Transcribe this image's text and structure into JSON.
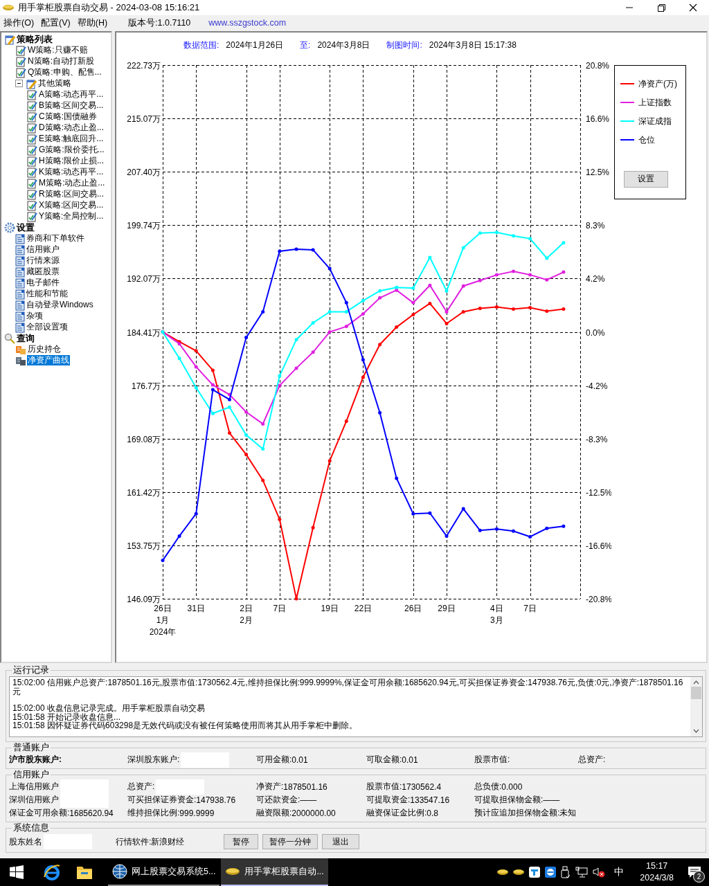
{
  "window": {
    "title": "用手掌柜股票自动交易 - 2024-03-08 15:16:21"
  },
  "menu": [
    "操作(O)",
    "配置(V)",
    "帮助(H)"
  ],
  "version": "版本号:1.0.7110",
  "website": "www.sszgstock.com",
  "sidebar": {
    "tree": [
      {
        "label": "策略列表",
        "kind": "group",
        "selected": false,
        "children": [
          {
            "label": "W策略:只赚不赔",
            "kind": "strategy",
            "selected": false
          },
          {
            "label": "N策略:自动打新股",
            "kind": "strategy",
            "selected": false
          },
          {
            "label": "Q策略:申购、配售...",
            "kind": "strategy",
            "selected": false
          },
          {
            "label": "其他策略",
            "kind": "group",
            "selected": false,
            "expanded": true,
            "children": [
              {
                "label": "A策略:动态再平...",
                "kind": "strategy",
                "selected": false
              },
              {
                "label": "B策略:区间交易...",
                "kind": "strategy",
                "selected": false
              },
              {
                "label": "C策略:国债融券",
                "kind": "strategy",
                "selected": false
              },
              {
                "label": "D策略:动态止盈...",
                "kind": "strategy",
                "selected": false
              },
              {
                "label": "E策略:触底回升...",
                "kind": "strategy",
                "selected": false
              },
              {
                "label": "G策略:限价委托...",
                "kind": "strategy",
                "selected": false
              },
              {
                "label": "H策略:限价止损...",
                "kind": "strategy",
                "selected": false
              },
              {
                "label": "K策略:动态再平...",
                "kind": "strategy",
                "selected": false
              },
              {
                "label": "M策略:动态止盈...",
                "kind": "strategy",
                "selected": false
              },
              {
                "label": "R策略:区间交易...",
                "kind": "strategy",
                "selected": false
              },
              {
                "label": "X策略:区间交易...",
                "kind": "strategy",
                "selected": false
              },
              {
                "label": "Y策略:全局控制...",
                "kind": "strategy",
                "selected": false
              }
            ]
          }
        ]
      },
      {
        "label": "设置",
        "kind": "settings",
        "selected": false,
        "children": [
          {
            "label": "券商和下单软件",
            "kind": "page",
            "selected": false
          },
          {
            "label": "信用账户",
            "kind": "page",
            "selected": false
          },
          {
            "label": "行情来源",
            "kind": "page",
            "selected": false
          },
          {
            "label": "藏匿股票",
            "kind": "page",
            "selected": false
          },
          {
            "label": "电子邮件",
            "kind": "page",
            "selected": false
          },
          {
            "label": "性能和节能",
            "kind": "page",
            "selected": false
          },
          {
            "label": "自动登录Windows",
            "kind": "page",
            "selected": false
          },
          {
            "label": "杂项",
            "kind": "page",
            "selected": false
          },
          {
            "label": "全部设置项",
            "kind": "page",
            "selected": false
          }
        ]
      },
      {
        "label": "查询",
        "kind": "query",
        "selected": false,
        "children": [
          {
            "label": "历史持仓",
            "kind": "history",
            "selected": false
          },
          {
            "label": "净资产曲线",
            "kind": "curve",
            "selected": true
          }
        ]
      }
    ]
  },
  "chart": {
    "header": [
      {
        "label": "数据范围:",
        "value": "2024年1月26日"
      },
      {
        "label": "至:",
        "value": "2024年3月8日"
      },
      {
        "label": "制图时间:",
        "value": "2024年3月8日 15:17:38"
      }
    ],
    "right_axis_labels": [
      "20.8%",
      "16.6%",
      "12.5%",
      "8.3%",
      "4.2%",
      "0.0%",
      "-4.2%",
      "-8.3%",
      "-12.5%",
      "-16.6%",
      "-20.8%"
    ],
    "legend_button": "设置",
    "chart_data": {
      "type": "line",
      "grid": true,
      "categories": [
        "26日\n1月\n2024年",
        null,
        "31日",
        null,
        null,
        "2日\n2月",
        null,
        "7日",
        null,
        null,
        "19日",
        null,
        "22日",
        null,
        null,
        "26日",
        null,
        "29日",
        null,
        null,
        "4日\n3月",
        null,
        "7日",
        null,
        null
      ],
      "ylim": [
        146.09,
        222.73
      ],
      "yticks": [
        {
          "value": 222.73,
          "label": "222.73万"
        },
        {
          "value": 215.07,
          "label": "215.07万"
        },
        {
          "value": 207.4,
          "label": "207.40万"
        },
        {
          "value": 199.74,
          "label": "199.74万"
        },
        {
          "value": 192.07,
          "label": "192.07万"
        },
        {
          "value": 184.41,
          "label": "184.41万"
        },
        {
          "value": 176.75,
          "label": "176.7万"
        },
        {
          "value": 169.08,
          "label": "169.08万"
        },
        {
          "value": 161.42,
          "label": "161.42万"
        },
        {
          "value": 153.75,
          "label": "153.75万"
        },
        {
          "value": 146.09,
          "label": "146.09万"
        }
      ],
      "series": [
        {
          "name": "净资产(万)",
          "color": "#ff0000",
          "values": [
            184.4,
            183.0,
            181.7,
            178.9,
            169.9,
            166.8,
            163.1,
            157.5,
            146.1,
            156.3,
            165.9,
            171.6,
            177.9,
            182.6,
            185.1,
            186.9,
            188.5,
            185.6,
            187.3,
            187.8,
            188.0,
            187.7,
            187.9,
            187.4,
            187.7
          ]
        },
        {
          "name": "上证指数",
          "color": "#e020e0",
          "values": [
            184.4,
            182.7,
            179.4,
            176.8,
            175.4,
            172.9,
            171.2,
            176.7,
            179.2,
            181.5,
            184.4,
            185.2,
            187.0,
            189.3,
            190.4,
            188.6,
            191.1,
            187.3,
            191.0,
            191.8,
            192.6,
            193.1,
            192.6,
            191.9,
            193.0
          ]
        },
        {
          "name": "深证成指",
          "color": "#00ffff",
          "values": [
            184.4,
            180.6,
            176.4,
            172.7,
            173.6,
            169.6,
            167.6,
            178.1,
            183.3,
            185.7,
            187.3,
            187.3,
            188.9,
            190.3,
            190.8,
            190.7,
            195.1,
            190.3,
            196.5,
            198.6,
            198.7,
            198.2,
            197.8,
            195.0,
            197.2
          ]
        },
        {
          "name": "仓位",
          "color": "#0000ff",
          "values": [
            151.6,
            155.1,
            158.3,
            176.1,
            174.7,
            183.6,
            187.3,
            196.0,
            196.3,
            196.2,
            193.5,
            188.6,
            180.4,
            172.8,
            163.4,
            158.3,
            158.4,
            155.1,
            159.0,
            155.9,
            156.1,
            155.8,
            155.0,
            156.2,
            156.5
          ]
        }
      ]
    }
  },
  "log": {
    "title": "运行记录",
    "lines": [
      "15:02:00 信用账户总资产:1878501.16元,股票市值:1730562.4元,维持担保比例:999.9999%,保证金可用余额:1685620.94元,可买担保证券资金:147938.76元,负债:0元,净资产:1878501.16元",
      "15:02:00 收盘信息记录完成。用手掌柜股票自动交易",
      "15:01:58 开始记录收盘信息...",
      "15:01:58 因怀疑证券代码603298是无效代码或没有被任何策略使用而将其从用手掌柜中删除。"
    ]
  },
  "normal_account": {
    "title": "普通账户",
    "fields": [
      {
        "label": "沪市股东账户:",
        "kind": "text"
      },
      {
        "label": "深圳股东账户:",
        "kind": "masked"
      },
      {
        "label": "可用金额:",
        "value": "0.01",
        "kind": "text"
      },
      {
        "label": "可取金额:",
        "value": "0.01",
        "kind": "text"
      },
      {
        "label": "股票市值:",
        "kind": "text"
      },
      {
        "label": "总资产:",
        "kind": "text"
      }
    ]
  },
  "credit_account": {
    "title": "信用账户",
    "fields": [
      {
        "label": "上海信用账户",
        "kind": "masked"
      },
      {
        "label": "总资产:",
        "kind": "masked"
      },
      {
        "label": "净资产:",
        "value": "1878501.16",
        "kind": "text"
      },
      {
        "label": "股票市值:",
        "value": "1730562.4",
        "kind": "text"
      },
      {
        "label": "总负债:",
        "value": "0.000",
        "kind": "text"
      },
      {
        "label": "深圳信用账户",
        "kind": "masked"
      },
      {
        "label": "可买担保证券资金:",
        "value": "147938.76",
        "kind": "text"
      },
      {
        "label": "可还款资金:",
        "value": "——",
        "kind": "text"
      },
      {
        "label": "可提取资金:",
        "value": "133547.16",
        "kind": "text"
      },
      {
        "label": "可提取担保物金额:",
        "value": "——",
        "kind": "text"
      },
      {
        "label": "保证金可用余额:",
        "value": "1685620.94",
        "kind": "text"
      },
      {
        "label": "维持担保比例:",
        "value": "999.9999",
        "kind": "text"
      },
      {
        "label": "融资限额:",
        "value": "2000000.00",
        "kind": "text"
      },
      {
        "label": "融资保证金比例:",
        "value": "0.8",
        "kind": "text"
      },
      {
        "label": "预计应追加担保物金额:",
        "value": "未知",
        "kind": "text"
      }
    ]
  },
  "system_info": {
    "title": "系统信息",
    "fields": [
      {
        "label": "股东姓名",
        "kind": "masked"
      },
      {
        "label": "行情软件:",
        "value": "新浪财经",
        "kind": "text"
      }
    ],
    "buttons": [
      "暂停",
      "暂停一分钟",
      "退出"
    ]
  },
  "taskbar": {
    "tasks": [
      {
        "label": "网上股票交易系统5...",
        "selected": false
      },
      {
        "label": "用手掌柜股票自动...",
        "selected": true
      }
    ],
    "ime": "中",
    "time": "15:17",
    "date": "2024/3/8",
    "notifications": "2"
  }
}
